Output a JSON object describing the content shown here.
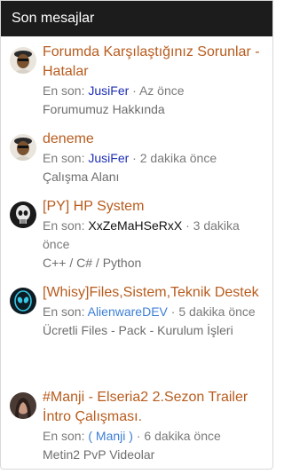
{
  "header": {
    "title": "Son mesajlar"
  },
  "messages": [
    {
      "title": "Forumda Karşılaştığınız Sorunlar - Hatalar",
      "prefix": "En son:",
      "user": "JusiFer",
      "user_color": "#1e2fb5",
      "sep": " · ",
      "time": "Az önce",
      "forum": "Forumumuz Hakkında",
      "avatar_icon": "gangster-avatar-icon"
    },
    {
      "title": "deneme",
      "prefix": "En son:",
      "user": "JusiFer",
      "user_color": "#1e2fb5",
      "sep": " · ",
      "time": "2 dakika önce",
      "forum": "Çalışma Alanı",
      "avatar_icon": "gangster-avatar-icon"
    },
    {
      "title": "[PY] HP System",
      "prefix": "En son:",
      "user": "XxZeMaHSeRxX",
      "user_color": "#111111",
      "sep": " · ",
      "time": "3 dakika önce",
      "forum": "C++ / C# / Python",
      "avatar_icon": "skull-avatar-icon"
    },
    {
      "title": "[Whisy]Files,Sistem,Teknik Destek",
      "prefix": "En son:",
      "user": "AlienwareDEV",
      "user_color": "#3d7fd6",
      "sep": " · ",
      "time": "5 dakika önce",
      "forum": "Ücretli Files - Pack - Kurulum İşleri",
      "avatar_icon": "alien-avatar-icon"
    },
    {
      "title": "#Manji - Elseria2 2.Sezon Trailer İntro Çalışması.",
      "prefix": "En son:",
      "user": "( Manji )",
      "user_color": "#3d7fd6",
      "sep": " · ",
      "time": "6 dakika önce",
      "forum": "Metin2 PvP Videolar",
      "avatar_icon": "portrait-avatar-icon"
    }
  ]
}
